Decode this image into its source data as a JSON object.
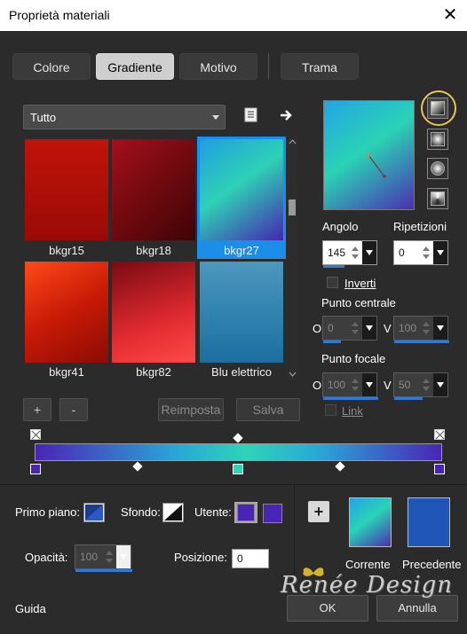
{
  "window": {
    "title": "Proprietà materiali",
    "close": "✕"
  },
  "tabs": [
    {
      "label": "Colore"
    },
    {
      "label": "Gradiente"
    },
    {
      "label": "Motivo"
    },
    {
      "label": "Trama"
    }
  ],
  "library": {
    "category": "Tutto",
    "items": [
      {
        "name": "bkgr15",
        "colors": [
          "#9a0a06",
          "#cc1a0a"
        ]
      },
      {
        "name": "bkgr18",
        "colors": [
          "#3d0406",
          "#a4101a"
        ]
      },
      {
        "name": "bkgr27",
        "colors": [
          "#1f9ee0",
          "#2ed1b6",
          "#4426b0"
        ]
      },
      {
        "name": "bkgr41",
        "colors": [
          "#ff4a1a",
          "#8a0c04"
        ]
      },
      {
        "name": "bkgr82",
        "colors": [
          "#7a0a12",
          "#ff3a3a"
        ]
      },
      {
        "name": "Blu elettrico",
        "colors": [
          "#3f8fba",
          "#1a6fa0"
        ]
      }
    ],
    "selected": "bkgr27",
    "add_button": "+",
    "remove_button": "-",
    "reset_button": "Reimposta",
    "save_button": "Salva"
  },
  "gradient": {
    "preview_colors": [
      "#23a3e6",
      "#2ad3b5",
      "#4a2fb2"
    ],
    "angle_label": "Angolo",
    "angle_value": "145",
    "repeats_label": "Ripetizioni",
    "repeats_value": "0",
    "invert_label": "Inverti",
    "center_label": "Punto centrale",
    "center_x_label": "O",
    "center_x_value": "0",
    "center_y_label": "V",
    "center_y_value": "100",
    "focal_label": "Punto focale",
    "focal_x_label": "O",
    "focal_x_value": "100",
    "focal_y_label": "V",
    "focal_y_value": "50",
    "link_label": "Link"
  },
  "editor": {
    "stops": [
      {
        "position": 0,
        "color": "#4a25b5"
      },
      {
        "position": 0.5,
        "color": "#2ed3b8"
      },
      {
        "position": 1,
        "color": "#4a25b5"
      }
    ]
  },
  "footer": {
    "foreground_label": "Primo piano:",
    "background_label": "Sfondo:",
    "user_label": "Utente:",
    "user_color_1": "#4a25b5",
    "user_color_2": "#4a25b5",
    "opacity_label": "Opacità:",
    "opacity_value": "100",
    "position_label": "Posizione:",
    "position_value": "0",
    "current_label": "Corrente",
    "previous_label": "Precedente",
    "current_colors": [
      "#2ad3b5",
      "#4a2fb2"
    ],
    "previous_color": "#1f55b5"
  },
  "bottom_bar": {
    "guide_label": "Guida",
    "ok_label": "OK",
    "cancel_label": "Annulla"
  },
  "watermark_text": "Renée Design"
}
